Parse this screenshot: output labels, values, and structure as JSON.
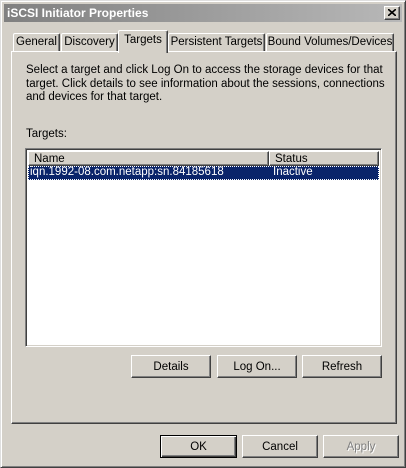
{
  "window": {
    "title": "iSCSI Initiator Properties"
  },
  "tabs": [
    {
      "label": "General"
    },
    {
      "label": "Discovery"
    },
    {
      "label": "Targets"
    },
    {
      "label": "Persistent Targets"
    },
    {
      "label": "Bound Volumes/Devices"
    }
  ],
  "targets_tab": {
    "description": "Select a target and click Log On to access the storage devices for that target. Click details to see information about the sessions, connections and devices for that target.",
    "targets_label": "Targets:",
    "columns": [
      {
        "label": "Name"
      },
      {
        "label": "Status"
      }
    ],
    "rows": [
      {
        "name": "iqn.1992-08.com.netapp:sn.84185618",
        "status": "Inactive"
      }
    ],
    "buttons": {
      "details": "Details",
      "logon": "Log On...",
      "refresh": "Refresh"
    }
  },
  "footer": {
    "ok": "OK",
    "cancel": "Cancel",
    "apply": "Apply"
  }
}
